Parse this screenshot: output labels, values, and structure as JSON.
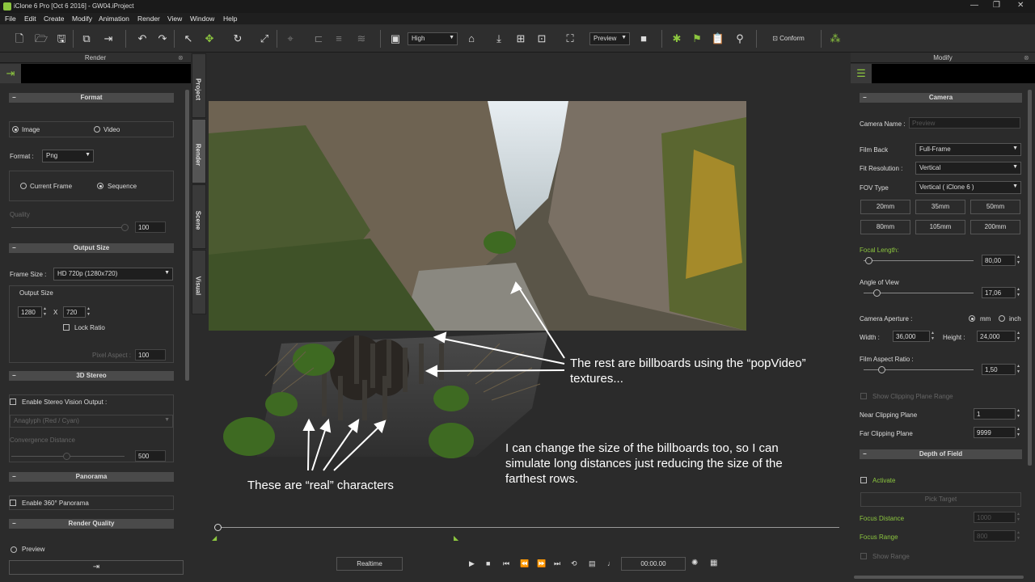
{
  "window": {
    "title": "iClone 6 Pro [Oct  6 2016] - GW04.iProject"
  },
  "menu": [
    "File",
    "Edit",
    "Create",
    "Modify",
    "Animation",
    "Render",
    "View",
    "Window",
    "Help"
  ],
  "toolbar": {
    "quality": "High",
    "preview": "Preview",
    "conform": "Conform"
  },
  "render_panel": {
    "title": "Render",
    "format_section": "Format",
    "image": "Image",
    "video": "Video",
    "format_label": "Format :",
    "format_value": "Png",
    "current_frame": "Current Frame",
    "sequence": "Sequence",
    "quality": "Quality",
    "quality_value": "100",
    "output_section": "Output Size",
    "frame_size_label": "Frame Size :",
    "frame_size_value": "HD 720p (1280x720)",
    "output_size_label": "Output Size",
    "width": "1280",
    "x": "X",
    "height": "720",
    "lock_ratio": "Lock Ratio",
    "pixel_aspect": "Pixel Aspect :",
    "pixel_aspect_value": "100",
    "stereo_section": "3D Stereo",
    "enable_stereo": "Enable Stereo Vision Output :",
    "anaglyph": "Anaglyph (Red / Cyan)",
    "convergence": "Convergence Distance",
    "convergence_value": "500",
    "panorama_section": "Panorama",
    "enable_panorama": "Enable 360° Panorama",
    "quality_section": "Render Quality",
    "preview": "Preview"
  },
  "side_tabs": [
    "Project",
    "Render",
    "Scene",
    "Visual"
  ],
  "viewport": {
    "ann1": "The rest are billboards using the “popVideo” textures...",
    "ann2": "These are “real” characters",
    "ann3": "I can change the size of the billboards too, so I can simulate long distances just reducing the size of the farthest rows."
  },
  "playback": {
    "realtime": "Realtime",
    "time": "00:00.00"
  },
  "modify_panel": {
    "title": "Modify",
    "camera_section": "Camera",
    "camera_name_label": "Camera Name :",
    "camera_name_placeholder": "Preview",
    "film_back_label": "Film Back",
    "film_back_value": "Full-Frame",
    "fit_resolution_label": "Fit Resolution :",
    "fit_resolution_value": "Vertical",
    "fov_type_label": "FOV Type",
    "fov_type_value": "Vertical ( iClone 6 )",
    "lenses": [
      "20mm",
      "35mm",
      "50mm",
      "80mm",
      "105mm",
      "200mm"
    ],
    "focal_length_label": "Focal Length:",
    "focal_length_value": "80,00",
    "angle_label": "Angle of View",
    "angle_value": "17,06",
    "aperture_label": "Camera Aperture :",
    "mm": "mm",
    "inch": "inch",
    "width_label": "Width :",
    "width_value": "36,000",
    "height_label": "Height :",
    "height_value": "24,000",
    "aspect_label": "Film Aspect Ratio :",
    "aspect_value": "1,50",
    "show_clipping": "Show Clipping Plane Range",
    "near_label": "Near Clipping Plane",
    "near_value": "1",
    "far_label": "Far Clipping Plane",
    "far_value": "9999",
    "dof_section": "Depth of Field",
    "activate": "Activate",
    "pick_target": "Pick Target",
    "focus_distance_label": "Focus Distance",
    "focus_distance_value": "1000",
    "focus_range_label": "Focus Range",
    "focus_range_value": "800",
    "show_range": "Show Range"
  }
}
